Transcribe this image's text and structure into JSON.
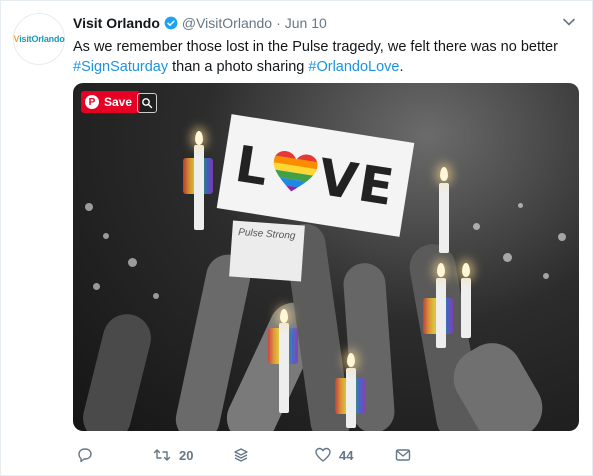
{
  "account": {
    "name": "Visit Orlando",
    "handle": "@VisitOrlando",
    "separator": "·",
    "date": "Jun 10",
    "avatar_text_v": "V",
    "avatar_text_rest": "isitOrlando"
  },
  "tweet": {
    "text_part1": "As we remember those lost in the Pulse tragedy, we felt there was no better",
    "hashtag1": "#SignSaturday",
    "text_part2": " than a photo sharing ",
    "hashtag2": "#OrlandoLove",
    "text_part3": "."
  },
  "media": {
    "sign_letters_1": "L",
    "sign_letters_2": "VE",
    "note_text": "Pulse Strong",
    "pinterest_save_label": "Save",
    "pinterest_logo": "P"
  },
  "actions": {
    "reply_icon": "reply-icon",
    "retweet_count": "20",
    "like_count": "44",
    "dm_icon": "envelope-icon"
  },
  "colors": {
    "hashtag": "#1b95e0",
    "verified": "#1da1f2",
    "pinterest": "#e60023",
    "muted": "#657786"
  }
}
